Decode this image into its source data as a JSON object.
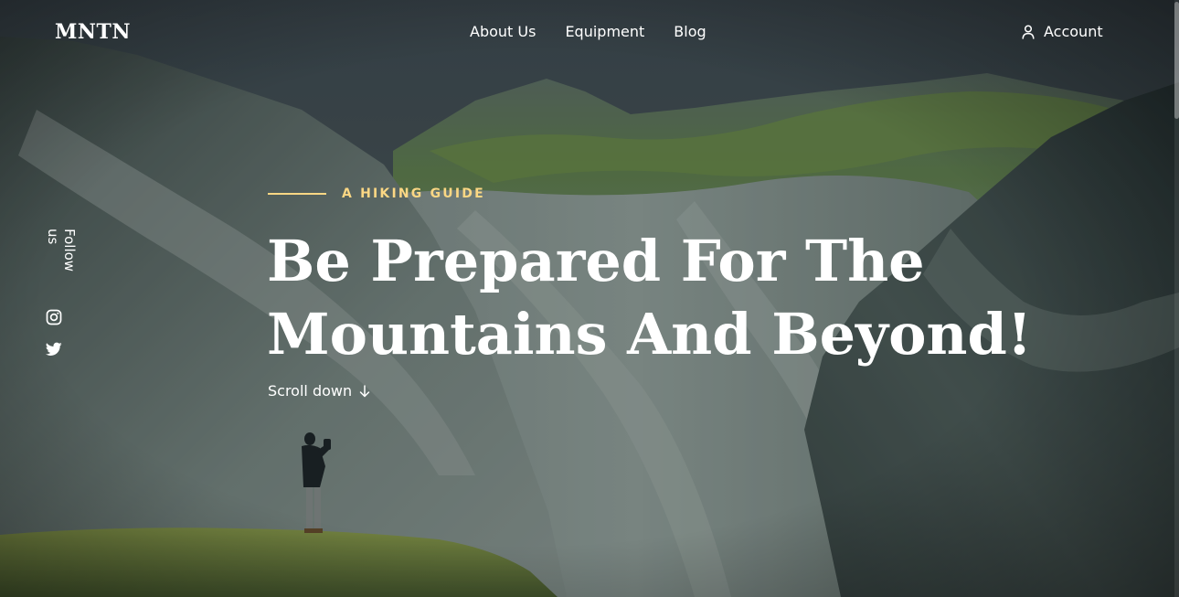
{
  "header": {
    "logo": "MNTN",
    "nav": [
      {
        "label": "About Us"
      },
      {
        "label": "Equipment"
      },
      {
        "label": "Blog"
      }
    ],
    "account_label": "Account",
    "account_icon": "user-icon"
  },
  "sidebar": {
    "follow_label": "Follow us",
    "social": [
      {
        "icon": "instagram-icon"
      },
      {
        "icon": "twitter-icon"
      }
    ]
  },
  "hero": {
    "eyebrow": "A HIKING GUIDE",
    "title_line1": "Be Prepared For The",
    "title_line2": "Mountains And Beyond!",
    "scroll_label": "Scroll down",
    "scroll_icon": "arrow-down-icon"
  },
  "colors": {
    "accent": "#fbd784",
    "text": "#ffffff",
    "background": "#1f2a30"
  }
}
